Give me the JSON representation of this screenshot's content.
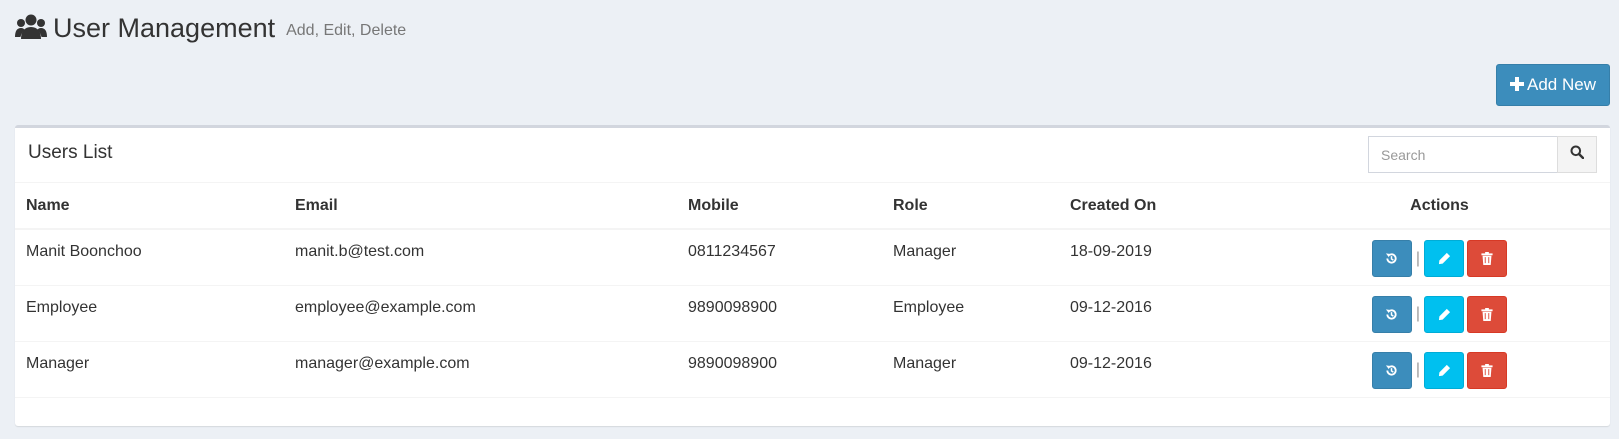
{
  "header": {
    "title": "User Management",
    "subtitle": "Add, Edit, Delete",
    "icon": "users-icon"
  },
  "toolbar": {
    "add_label": "Add New",
    "add_icon": "plus-icon",
    "add_color": "#3c8dbc"
  },
  "box": {
    "title": "Users List"
  },
  "search": {
    "placeholder": "Search",
    "value": "",
    "icon": "search-icon"
  },
  "table": {
    "columns": [
      "Name",
      "Email",
      "Mobile",
      "Role",
      "Created On",
      "Actions"
    ],
    "rows": [
      {
        "name": "Manit Boonchoo",
        "email": "manit.b@test.com",
        "mobile": "0811234567",
        "role": "Manager",
        "created_on": "18-09-2019"
      },
      {
        "name": "Employee",
        "email": "employee@example.com",
        "mobile": "9890098900",
        "role": "Employee",
        "created_on": "09-12-2016"
      },
      {
        "name": "Manager",
        "email": "manager@example.com",
        "mobile": "9890098900",
        "role": "Manager",
        "created_on": "09-12-2016"
      }
    ],
    "action_icons": [
      "history-icon",
      "pencil-icon",
      "trash-icon"
    ],
    "action_colors": {
      "history": "#3c8dbc",
      "edit": "#00c0ef",
      "delete": "#dd4b39"
    },
    "separator": "|"
  }
}
